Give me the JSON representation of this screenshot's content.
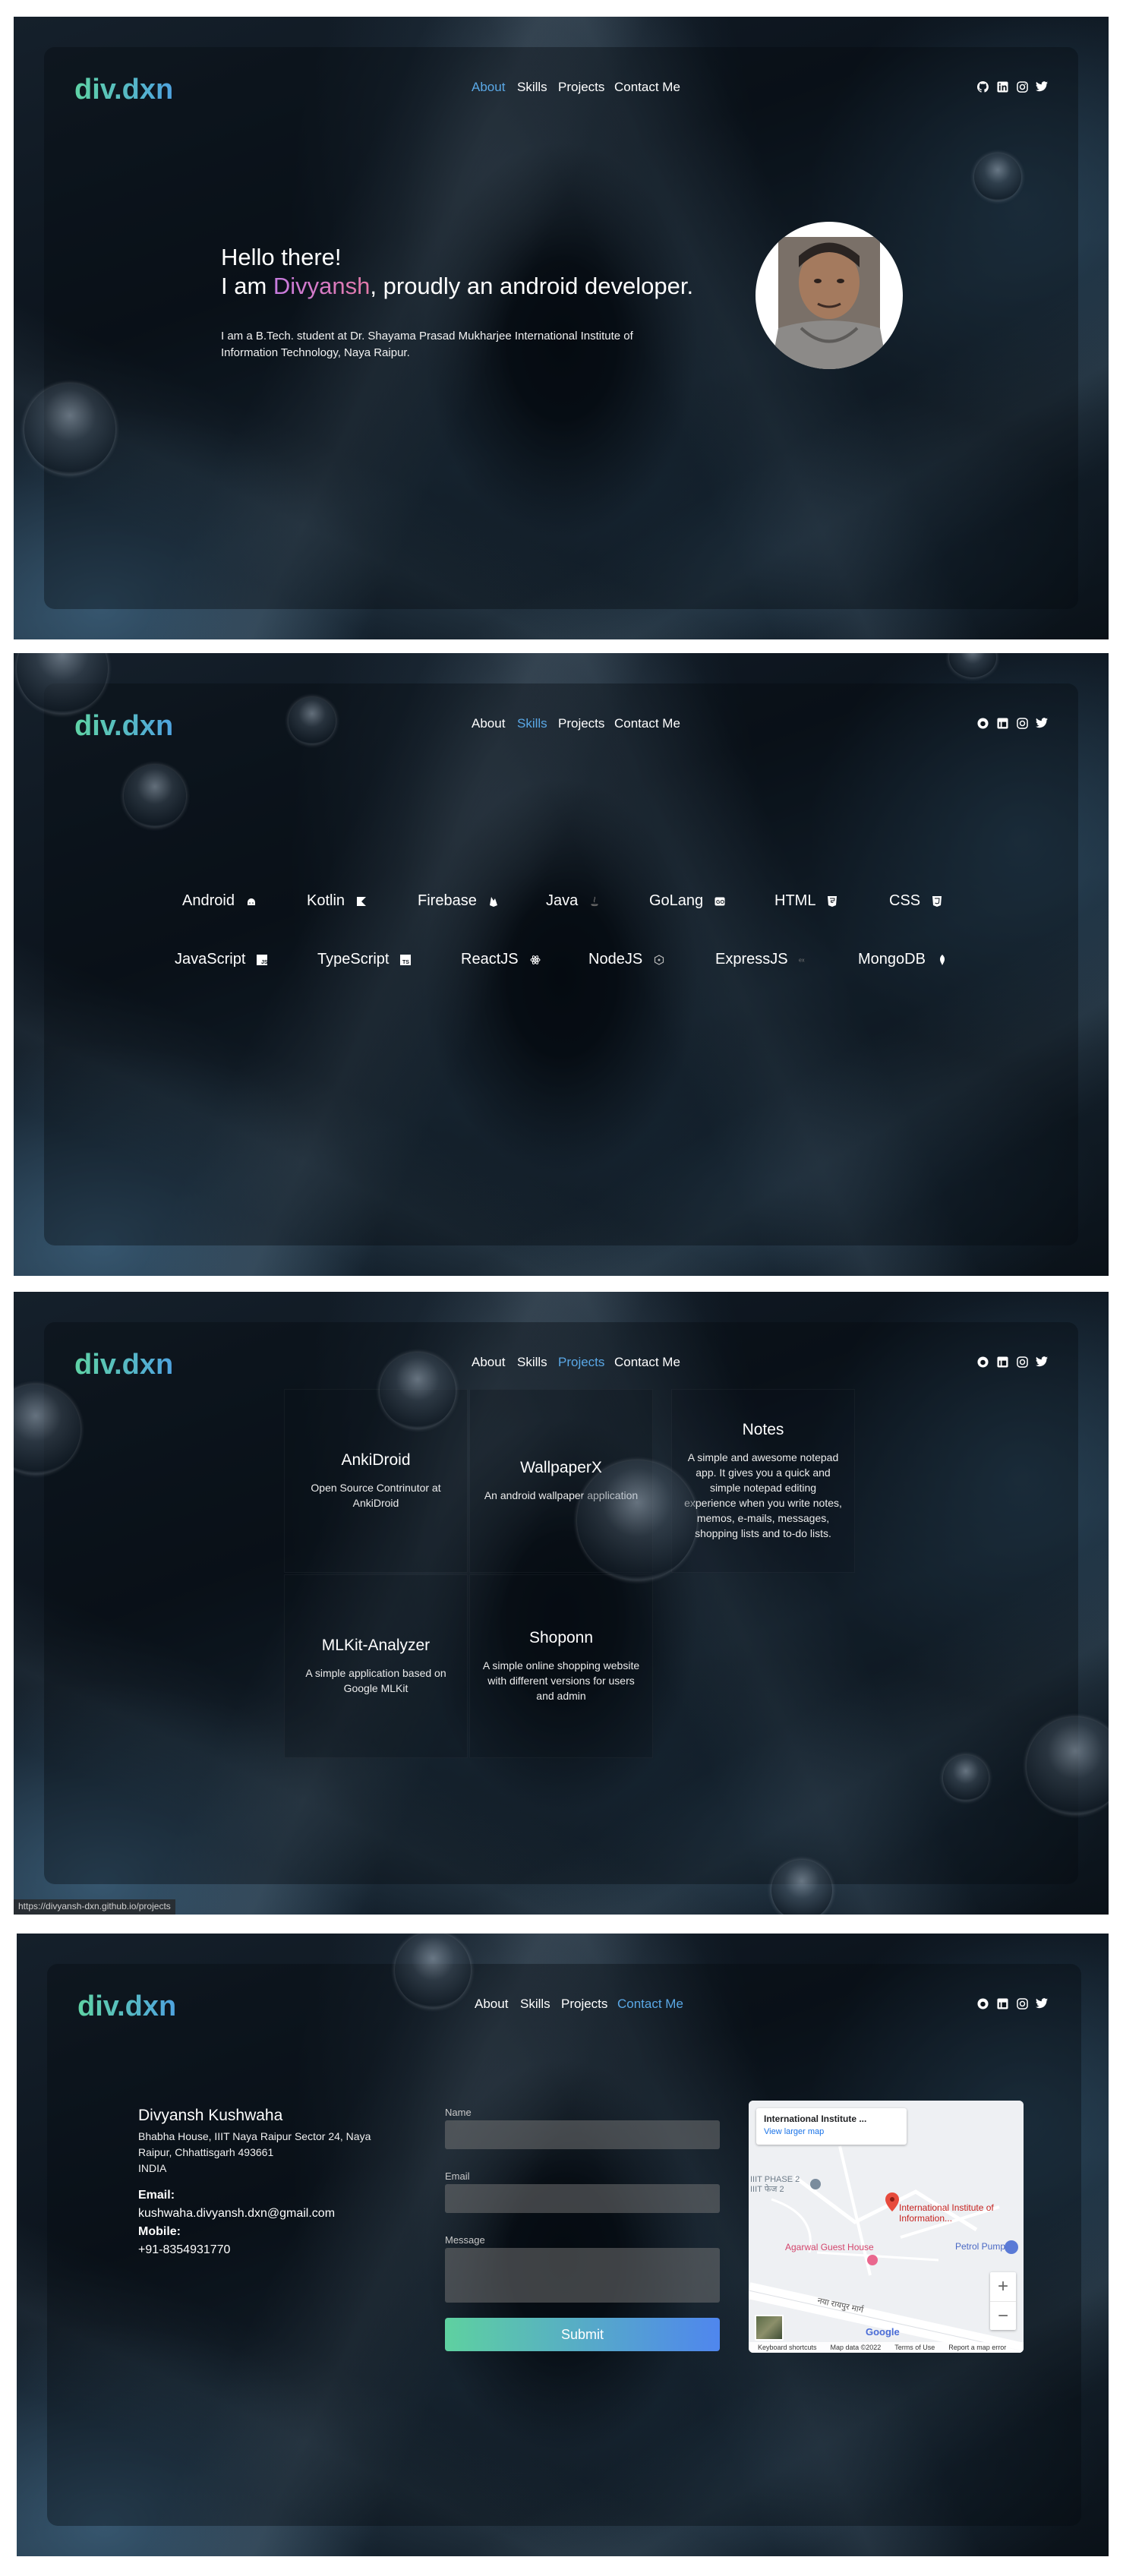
{
  "brand": {
    "logo": "div.dxn"
  },
  "nav": {
    "about": "About",
    "skills": "Skills",
    "projects": "Projects",
    "contact": "Contact Me"
  },
  "social": [
    "github-icon",
    "linkedin-icon",
    "instagram-icon",
    "twitter-icon"
  ],
  "colors": {
    "accent": "#5aa8e6",
    "logo_start": "#5fd3a5",
    "logo_end": "#4fa3e0",
    "name_start": "#c77be0",
    "name_end": "#e47aa8"
  },
  "about": {
    "greeting": "Hello there!",
    "line_prefix": "I am ",
    "name": "Divyansh",
    "line_suffix": ", proudly an android developer.",
    "bio": "I am a B.Tech. student at Dr. Shayama Prasad Mukharjee International Institute of Information Technology, Naya Raipur."
  },
  "skills": {
    "row1": [
      {
        "label": "Android",
        "icon": "android-icon"
      },
      {
        "label": "Kotlin",
        "icon": "kotlin-icon"
      },
      {
        "label": "Firebase",
        "icon": "firebase-icon"
      },
      {
        "label": "Java",
        "icon": "java-icon"
      },
      {
        "label": "GoLang",
        "icon": "golang-icon"
      },
      {
        "label": "HTML",
        "icon": "html-icon"
      },
      {
        "label": "CSS",
        "icon": "css-icon"
      }
    ],
    "row2": [
      {
        "label": "JavaScript",
        "icon": "javascript-icon"
      },
      {
        "label": "TypeScript",
        "icon": "typescript-icon"
      },
      {
        "label": "ReactJS",
        "icon": "react-icon"
      },
      {
        "label": "NodeJS",
        "icon": "nodejs-icon"
      },
      {
        "label": "ExpressJS",
        "icon": "express-icon"
      },
      {
        "label": "MongoDB",
        "icon": "mongodb-icon"
      }
    ]
  },
  "projects": {
    "items": [
      {
        "title": "AnkiDroid",
        "desc": "Open Source Contrinutor at AnkiDroid"
      },
      {
        "title": "WallpaperX",
        "desc": "An android wallpaper application"
      },
      {
        "title": "Notes",
        "desc": "A simple and awesome notepad app. It gives you a quick and simple notepad editing experience when you write notes, memos, e-mails, messages, shopping lists and to-do lists."
      },
      {
        "title": "MLKit-Analyzer",
        "desc": "A simple application based on Google MLKit"
      },
      {
        "title": "Shoponn",
        "desc": "A simple online shopping website with different versions for users and admin"
      }
    ],
    "status_url": "https://divyansh-dxn.github.io/projects"
  },
  "contact": {
    "name": "Divyansh Kushwaha",
    "address": "Bhabha House, IIIT Naya Raipur Sector 24, Naya Raipur, Chhattisgarh 493661",
    "country": "INDIA",
    "email_label": "Email:",
    "email": "kushwaha.divyansh.dxn@gmail.com",
    "mobile_label": "Mobile:",
    "mobile": "+91-8354931770",
    "form": {
      "name_label": "Name",
      "email_label": "Email",
      "message_label": "Message",
      "submit": "Submit"
    },
    "map": {
      "place_title": "International Institute ...",
      "larger_map": "View larger map",
      "marker_label": "International Institute of Information...",
      "guest_house": "Agarwal Guest House",
      "petrol_pump": "Petrol Pump",
      "phase": "IIIT PHASE 2",
      "phase_hi": "IIIT फेज 2",
      "road": "नया रायपुर मार्ग",
      "google": "Google",
      "footer_shortcuts": "Keyboard shortcuts",
      "footer_data": "Map data ©2022",
      "footer_terms": "Terms of Use",
      "footer_report": "Report a map error",
      "zoom_in": "+",
      "zoom_out": "−"
    }
  }
}
